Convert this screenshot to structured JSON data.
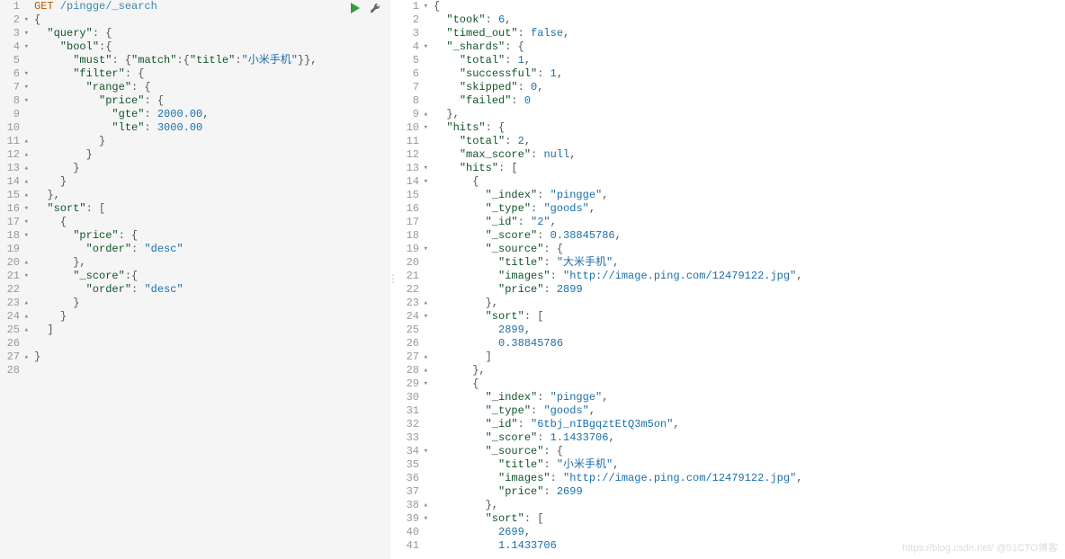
{
  "request": {
    "method": "GET",
    "path": "/pingge/_search",
    "body_lines": [
      {
        "n": 1,
        "fold": "",
        "tokens": [
          [
            "method",
            "GET"
          ],
          [
            "plain",
            " "
          ],
          [
            "path",
            "/pingge/_search"
          ]
        ]
      },
      {
        "n": 2,
        "fold": "▾",
        "tokens": [
          [
            "punc",
            "{"
          ]
        ]
      },
      {
        "n": 3,
        "fold": "▾",
        "tokens": [
          [
            "plain",
            "  "
          ],
          [
            "key",
            "\"query\""
          ],
          [
            "punc",
            ": {"
          ]
        ]
      },
      {
        "n": 4,
        "fold": "▾",
        "tokens": [
          [
            "plain",
            "    "
          ],
          [
            "key",
            "\"bool\""
          ],
          [
            "punc",
            ":{"
          ]
        ]
      },
      {
        "n": 5,
        "fold": "",
        "hl": true,
        "tokens": [
          [
            "plain",
            "      "
          ],
          [
            "key",
            "\"must\""
          ],
          [
            "punc",
            ": {"
          ],
          [
            "key",
            "\"match\""
          ],
          [
            "punc",
            ":{"
          ],
          [
            "key",
            "\"title\""
          ],
          [
            "punc",
            ":"
          ],
          [
            "string",
            "\"小米手机\""
          ],
          [
            "punc",
            "}},"
          ]
        ]
      },
      {
        "n": 6,
        "fold": "▾",
        "tokens": [
          [
            "plain",
            "      "
          ],
          [
            "key",
            "\"filter\""
          ],
          [
            "punc",
            ": {"
          ]
        ]
      },
      {
        "n": 7,
        "fold": "▾",
        "tokens": [
          [
            "plain",
            "        "
          ],
          [
            "key",
            "\"range\""
          ],
          [
            "punc",
            ": {"
          ]
        ]
      },
      {
        "n": 8,
        "fold": "▾",
        "tokens": [
          [
            "plain",
            "          "
          ],
          [
            "key",
            "\"price\""
          ],
          [
            "punc",
            ": {"
          ]
        ]
      },
      {
        "n": 9,
        "fold": "",
        "tokens": [
          [
            "plain",
            "            "
          ],
          [
            "key",
            "\"gte\""
          ],
          [
            "punc",
            ": "
          ],
          [
            "num",
            "2000.00"
          ],
          [
            "punc",
            ","
          ]
        ]
      },
      {
        "n": 10,
        "fold": "",
        "tokens": [
          [
            "plain",
            "            "
          ],
          [
            "key",
            "\"lte\""
          ],
          [
            "punc",
            ": "
          ],
          [
            "num",
            "3000.00"
          ]
        ]
      },
      {
        "n": 11,
        "fold": "▴",
        "tokens": [
          [
            "plain",
            "          "
          ],
          [
            "punc",
            "}"
          ]
        ]
      },
      {
        "n": 12,
        "fold": "▴",
        "tokens": [
          [
            "plain",
            "        "
          ],
          [
            "punc",
            "}"
          ]
        ]
      },
      {
        "n": 13,
        "fold": "▴",
        "tokens": [
          [
            "plain",
            "      "
          ],
          [
            "punc",
            "}"
          ]
        ]
      },
      {
        "n": 14,
        "fold": "▴",
        "tokens": [
          [
            "plain",
            "    "
          ],
          [
            "punc",
            "}"
          ]
        ]
      },
      {
        "n": 15,
        "fold": "▴",
        "tokens": [
          [
            "plain",
            "  "
          ],
          [
            "punc",
            "},"
          ]
        ]
      },
      {
        "n": 16,
        "fold": "▾",
        "tokens": [
          [
            "plain",
            "  "
          ],
          [
            "key",
            "\"sort\""
          ],
          [
            "punc",
            ": ["
          ]
        ]
      },
      {
        "n": 17,
        "fold": "▾",
        "tokens": [
          [
            "plain",
            "    "
          ],
          [
            "punc",
            "{"
          ]
        ]
      },
      {
        "n": 18,
        "fold": "▾",
        "tokens": [
          [
            "plain",
            "      "
          ],
          [
            "key",
            "\"price\""
          ],
          [
            "punc",
            ": {"
          ]
        ]
      },
      {
        "n": 19,
        "fold": "",
        "tokens": [
          [
            "plain",
            "        "
          ],
          [
            "key",
            "\"order\""
          ],
          [
            "punc",
            ": "
          ],
          [
            "string",
            "\"desc\""
          ]
        ]
      },
      {
        "n": 20,
        "fold": "▴",
        "tokens": [
          [
            "plain",
            "      "
          ],
          [
            "punc",
            "},"
          ]
        ]
      },
      {
        "n": 21,
        "fold": "▾",
        "tokens": [
          [
            "plain",
            "      "
          ],
          [
            "key",
            "\"_score\""
          ],
          [
            "punc",
            ":{"
          ]
        ]
      },
      {
        "n": 22,
        "fold": "",
        "tokens": [
          [
            "plain",
            "        "
          ],
          [
            "key",
            "\"order\""
          ],
          [
            "punc",
            ": "
          ],
          [
            "string",
            "\"desc\""
          ]
        ]
      },
      {
        "n": 23,
        "fold": "▴",
        "tokens": [
          [
            "plain",
            "      "
          ],
          [
            "punc",
            "}"
          ]
        ]
      },
      {
        "n": 24,
        "fold": "▴",
        "tokens": [
          [
            "plain",
            "    "
          ],
          [
            "punc",
            "}"
          ]
        ]
      },
      {
        "n": 25,
        "fold": "▴",
        "tokens": [
          [
            "plain",
            "  "
          ],
          [
            "punc",
            "]"
          ]
        ]
      },
      {
        "n": 26,
        "fold": "",
        "tokens": [
          [
            "plain",
            ""
          ]
        ]
      },
      {
        "n": 27,
        "fold": "▴",
        "tokens": [
          [
            "punc",
            "}"
          ]
        ]
      },
      {
        "n": 28,
        "fold": "",
        "tokens": [
          [
            "plain",
            ""
          ]
        ]
      }
    ]
  },
  "response_lines": [
    {
      "n": 1,
      "fold": "▾",
      "tokens": [
        [
          "punc",
          "{"
        ]
      ]
    },
    {
      "n": 2,
      "fold": "",
      "tokens": [
        [
          "plain",
          "  "
        ],
        [
          "key",
          "\"took\""
        ],
        [
          "punc",
          ": "
        ],
        [
          "num",
          "6"
        ],
        [
          "punc",
          ","
        ]
      ]
    },
    {
      "n": 3,
      "fold": "",
      "tokens": [
        [
          "plain",
          "  "
        ],
        [
          "key",
          "\"timed_out\""
        ],
        [
          "punc",
          ": "
        ],
        [
          "bool",
          "false"
        ],
        [
          "punc",
          ","
        ]
      ]
    },
    {
      "n": 4,
      "fold": "▾",
      "tokens": [
        [
          "plain",
          "  "
        ],
        [
          "key",
          "\"_shards\""
        ],
        [
          "punc",
          ": {"
        ]
      ]
    },
    {
      "n": 5,
      "fold": "",
      "tokens": [
        [
          "plain",
          "    "
        ],
        [
          "key",
          "\"total\""
        ],
        [
          "punc",
          ": "
        ],
        [
          "num",
          "1"
        ],
        [
          "punc",
          ","
        ]
      ]
    },
    {
      "n": 6,
      "fold": "",
      "tokens": [
        [
          "plain",
          "    "
        ],
        [
          "key",
          "\"successful\""
        ],
        [
          "punc",
          ": "
        ],
        [
          "num",
          "1"
        ],
        [
          "punc",
          ","
        ]
      ]
    },
    {
      "n": 7,
      "fold": "",
      "tokens": [
        [
          "plain",
          "    "
        ],
        [
          "key",
          "\"skipped\""
        ],
        [
          "punc",
          ": "
        ],
        [
          "num",
          "0"
        ],
        [
          "punc",
          ","
        ]
      ]
    },
    {
      "n": 8,
      "fold": "",
      "tokens": [
        [
          "plain",
          "    "
        ],
        [
          "key",
          "\"failed\""
        ],
        [
          "punc",
          ": "
        ],
        [
          "num",
          "0"
        ]
      ]
    },
    {
      "n": 9,
      "fold": "▴",
      "tokens": [
        [
          "plain",
          "  "
        ],
        [
          "punc",
          "},"
        ]
      ]
    },
    {
      "n": 10,
      "fold": "▾",
      "tokens": [
        [
          "plain",
          "  "
        ],
        [
          "key",
          "\"hits\""
        ],
        [
          "punc",
          ": {"
        ]
      ]
    },
    {
      "n": 11,
      "fold": "",
      "tokens": [
        [
          "plain",
          "    "
        ],
        [
          "key",
          "\"total\""
        ],
        [
          "punc",
          ": "
        ],
        [
          "num",
          "2"
        ],
        [
          "punc",
          ","
        ]
      ]
    },
    {
      "n": 12,
      "fold": "",
      "tokens": [
        [
          "plain",
          "    "
        ],
        [
          "key",
          "\"max_score\""
        ],
        [
          "punc",
          ": "
        ],
        [
          "bool",
          "null"
        ],
        [
          "punc",
          ","
        ]
      ]
    },
    {
      "n": 13,
      "fold": "▾",
      "tokens": [
        [
          "plain",
          "    "
        ],
        [
          "key",
          "\"hits\""
        ],
        [
          "punc",
          ": ["
        ]
      ]
    },
    {
      "n": 14,
      "fold": "▾",
      "tokens": [
        [
          "plain",
          "      "
        ],
        [
          "punc",
          "{"
        ]
      ]
    },
    {
      "n": 15,
      "fold": "",
      "tokens": [
        [
          "plain",
          "        "
        ],
        [
          "key",
          "\"_index\""
        ],
        [
          "punc",
          ": "
        ],
        [
          "string",
          "\"pingge\""
        ],
        [
          "punc",
          ","
        ]
      ]
    },
    {
      "n": 16,
      "fold": "",
      "tokens": [
        [
          "plain",
          "        "
        ],
        [
          "key",
          "\"_type\""
        ],
        [
          "punc",
          ": "
        ],
        [
          "string",
          "\"goods\""
        ],
        [
          "punc",
          ","
        ]
      ]
    },
    {
      "n": 17,
      "fold": "",
      "tokens": [
        [
          "plain",
          "        "
        ],
        [
          "key",
          "\"_id\""
        ],
        [
          "punc",
          ": "
        ],
        [
          "string",
          "\"2\""
        ],
        [
          "punc",
          ","
        ]
      ]
    },
    {
      "n": 18,
      "fold": "",
      "tokens": [
        [
          "plain",
          "        "
        ],
        [
          "key",
          "\"_score\""
        ],
        [
          "punc",
          ": "
        ],
        [
          "num",
          "0.38845786"
        ],
        [
          "punc",
          ","
        ]
      ]
    },
    {
      "n": 19,
      "fold": "▾",
      "tokens": [
        [
          "plain",
          "        "
        ],
        [
          "key",
          "\"_source\""
        ],
        [
          "punc",
          ": {"
        ]
      ]
    },
    {
      "n": 20,
      "fold": "",
      "tokens": [
        [
          "plain",
          "          "
        ],
        [
          "key",
          "\"title\""
        ],
        [
          "punc",
          ": "
        ],
        [
          "string",
          "\"大米手机\""
        ],
        [
          "punc",
          ","
        ]
      ]
    },
    {
      "n": 21,
      "fold": "",
      "tokens": [
        [
          "plain",
          "          "
        ],
        [
          "key",
          "\"images\""
        ],
        [
          "punc",
          ": "
        ],
        [
          "string",
          "\"http://image.ping.com/12479122.jpg\""
        ],
        [
          "punc",
          ","
        ]
      ]
    },
    {
      "n": 22,
      "fold": "",
      "tokens": [
        [
          "plain",
          "          "
        ],
        [
          "key",
          "\"price\""
        ],
        [
          "punc",
          ": "
        ],
        [
          "num",
          "2899"
        ]
      ]
    },
    {
      "n": 23,
      "fold": "▴",
      "tokens": [
        [
          "plain",
          "        "
        ],
        [
          "punc",
          "},"
        ]
      ]
    },
    {
      "n": 24,
      "fold": "▾",
      "tokens": [
        [
          "plain",
          "        "
        ],
        [
          "key",
          "\"sort\""
        ],
        [
          "punc",
          ": ["
        ]
      ]
    },
    {
      "n": 25,
      "fold": "",
      "tokens": [
        [
          "plain",
          "          "
        ],
        [
          "num",
          "2899"
        ],
        [
          "punc",
          ","
        ]
      ]
    },
    {
      "n": 26,
      "fold": "",
      "tokens": [
        [
          "plain",
          "          "
        ],
        [
          "num",
          "0.38845786"
        ]
      ]
    },
    {
      "n": 27,
      "fold": "▴",
      "tokens": [
        [
          "plain",
          "        "
        ],
        [
          "punc",
          "]"
        ]
      ]
    },
    {
      "n": 28,
      "fold": "▴",
      "tokens": [
        [
          "plain",
          "      "
        ],
        [
          "punc",
          "},"
        ]
      ]
    },
    {
      "n": 29,
      "fold": "▾",
      "tokens": [
        [
          "plain",
          "      "
        ],
        [
          "punc",
          "{"
        ]
      ]
    },
    {
      "n": 30,
      "fold": "",
      "tokens": [
        [
          "plain",
          "        "
        ],
        [
          "key",
          "\"_index\""
        ],
        [
          "punc",
          ": "
        ],
        [
          "string",
          "\"pingge\""
        ],
        [
          "punc",
          ","
        ]
      ]
    },
    {
      "n": 31,
      "fold": "",
      "tokens": [
        [
          "plain",
          "        "
        ],
        [
          "key",
          "\"_type\""
        ],
        [
          "punc",
          ": "
        ],
        [
          "string",
          "\"goods\""
        ],
        [
          "punc",
          ","
        ]
      ]
    },
    {
      "n": 32,
      "fold": "",
      "tokens": [
        [
          "plain",
          "        "
        ],
        [
          "key",
          "\"_id\""
        ],
        [
          "punc",
          ": "
        ],
        [
          "string",
          "\"6tbj_nIBgqztEtQ3m5on\""
        ],
        [
          "punc",
          ","
        ]
      ]
    },
    {
      "n": 33,
      "fold": "",
      "tokens": [
        [
          "plain",
          "        "
        ],
        [
          "key",
          "\"_score\""
        ],
        [
          "punc",
          ": "
        ],
        [
          "num",
          "1.1433706"
        ],
        [
          "punc",
          ","
        ]
      ]
    },
    {
      "n": 34,
      "fold": "▾",
      "tokens": [
        [
          "plain",
          "        "
        ],
        [
          "key",
          "\"_source\""
        ],
        [
          "punc",
          ": {"
        ]
      ]
    },
    {
      "n": 35,
      "fold": "",
      "tokens": [
        [
          "plain",
          "          "
        ],
        [
          "key",
          "\"title\""
        ],
        [
          "punc",
          ": "
        ],
        [
          "string",
          "\"小米手机\""
        ],
        [
          "punc",
          ","
        ]
      ]
    },
    {
      "n": 36,
      "fold": "",
      "tokens": [
        [
          "plain",
          "          "
        ],
        [
          "key",
          "\"images\""
        ],
        [
          "punc",
          ": "
        ],
        [
          "string",
          "\"http://image.ping.com/12479122.jpg\""
        ],
        [
          "punc",
          ","
        ]
      ]
    },
    {
      "n": 37,
      "fold": "",
      "tokens": [
        [
          "plain",
          "          "
        ],
        [
          "key",
          "\"price\""
        ],
        [
          "punc",
          ": "
        ],
        [
          "num",
          "2699"
        ]
      ]
    },
    {
      "n": 38,
      "fold": "▴",
      "tokens": [
        [
          "plain",
          "        "
        ],
        [
          "punc",
          "},"
        ]
      ]
    },
    {
      "n": 39,
      "fold": "▾",
      "tokens": [
        [
          "plain",
          "        "
        ],
        [
          "key",
          "\"sort\""
        ],
        [
          "punc",
          ": ["
        ]
      ]
    },
    {
      "n": 40,
      "fold": "",
      "tokens": [
        [
          "plain",
          "          "
        ],
        [
          "num",
          "2699"
        ],
        [
          "punc",
          ","
        ]
      ]
    },
    {
      "n": 41,
      "fold": "",
      "tokens": [
        [
          "plain",
          "          "
        ],
        [
          "num",
          "1.1433706"
        ]
      ]
    }
  ],
  "watermark": "https://blog.csdn.net/  @51CTO博客"
}
